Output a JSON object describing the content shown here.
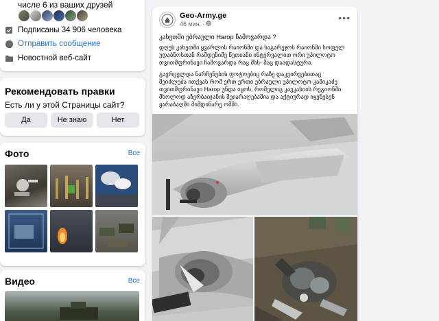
{
  "about": {
    "friends_text": "числе 6 из ваших друзей",
    "subscribers": "Подписаны 34 906 человека",
    "send_message": "Отправить сообщение",
    "website": "Новостной веб-сайт"
  },
  "recommend": {
    "title": "Рекомендовать правки",
    "question": "Есть ли у этой Страницы сайт?",
    "buttons": [
      "Да",
      "Не знаю",
      "Нет"
    ]
  },
  "photos": {
    "title": "Фото",
    "see_all": "Все"
  },
  "video": {
    "title": "Видео",
    "see_all": "Все"
  },
  "post": {
    "page_name": "Geo-Army.ge",
    "time": "46 мин.",
    "question": "კახეთში ებრაული Harop ჩამოვარდა ?",
    "paragraph1": "დღეს კახეთში ყვარლის რაიონში და საგარეჯოს რაიონში სოფელ უდაბნოსთან რამდენიმე წუთიანი ინტერვალით ორი უპილოტო თვითმფრინავი ჩამოვარდა რაც შსს- მაც დაადასტურა.",
    "paragraph2": "გავრცელდა ნარჩენების ფოტოებიც რაზე დაკვირვებითაც შეიძლება ითქვას რომ ერთ ერთი ებრაული უპილოტო-კამიკაძე თვითმფრინავი Harop უნდა იყოს, რომელიც კავკასიის რეგიონში მხოლოდ აზერბაიჯანის შეიარაღებაშია და აქტიურად იყენებენ ყარაბაღში მიმდინარე ომში."
  },
  "colors": {
    "link": "#216fdb",
    "bg": "#f0f2f5",
    "card": "#ffffff",
    "button": "#e4e6eb"
  }
}
